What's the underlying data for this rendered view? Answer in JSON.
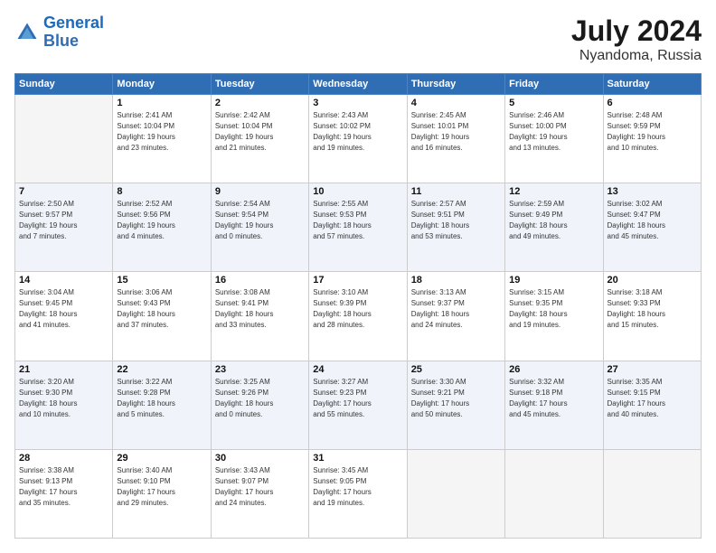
{
  "header": {
    "logo_line1": "General",
    "logo_line2": "Blue",
    "main_title": "July 2024",
    "subtitle": "Nyandoma, Russia"
  },
  "weekdays": [
    "Sunday",
    "Monday",
    "Tuesday",
    "Wednesday",
    "Thursday",
    "Friday",
    "Saturday"
  ],
  "weeks": [
    [
      {
        "day": "",
        "info": ""
      },
      {
        "day": "1",
        "info": "Sunrise: 2:41 AM\nSunset: 10:04 PM\nDaylight: 19 hours\nand 23 minutes."
      },
      {
        "day": "2",
        "info": "Sunrise: 2:42 AM\nSunset: 10:04 PM\nDaylight: 19 hours\nand 21 minutes."
      },
      {
        "day": "3",
        "info": "Sunrise: 2:43 AM\nSunset: 10:02 PM\nDaylight: 19 hours\nand 19 minutes."
      },
      {
        "day": "4",
        "info": "Sunrise: 2:45 AM\nSunset: 10:01 PM\nDaylight: 19 hours\nand 16 minutes."
      },
      {
        "day": "5",
        "info": "Sunrise: 2:46 AM\nSunset: 10:00 PM\nDaylight: 19 hours\nand 13 minutes."
      },
      {
        "day": "6",
        "info": "Sunrise: 2:48 AM\nSunset: 9:59 PM\nDaylight: 19 hours\nand 10 minutes."
      }
    ],
    [
      {
        "day": "7",
        "info": "Sunrise: 2:50 AM\nSunset: 9:57 PM\nDaylight: 19 hours\nand 7 minutes."
      },
      {
        "day": "8",
        "info": "Sunrise: 2:52 AM\nSunset: 9:56 PM\nDaylight: 19 hours\nand 4 minutes."
      },
      {
        "day": "9",
        "info": "Sunrise: 2:54 AM\nSunset: 9:54 PM\nDaylight: 19 hours\nand 0 minutes."
      },
      {
        "day": "10",
        "info": "Sunrise: 2:55 AM\nSunset: 9:53 PM\nDaylight: 18 hours\nand 57 minutes."
      },
      {
        "day": "11",
        "info": "Sunrise: 2:57 AM\nSunset: 9:51 PM\nDaylight: 18 hours\nand 53 minutes."
      },
      {
        "day": "12",
        "info": "Sunrise: 2:59 AM\nSunset: 9:49 PM\nDaylight: 18 hours\nand 49 minutes."
      },
      {
        "day": "13",
        "info": "Sunrise: 3:02 AM\nSunset: 9:47 PM\nDaylight: 18 hours\nand 45 minutes."
      }
    ],
    [
      {
        "day": "14",
        "info": "Sunrise: 3:04 AM\nSunset: 9:45 PM\nDaylight: 18 hours\nand 41 minutes."
      },
      {
        "day": "15",
        "info": "Sunrise: 3:06 AM\nSunset: 9:43 PM\nDaylight: 18 hours\nand 37 minutes."
      },
      {
        "day": "16",
        "info": "Sunrise: 3:08 AM\nSunset: 9:41 PM\nDaylight: 18 hours\nand 33 minutes."
      },
      {
        "day": "17",
        "info": "Sunrise: 3:10 AM\nSunset: 9:39 PM\nDaylight: 18 hours\nand 28 minutes."
      },
      {
        "day": "18",
        "info": "Sunrise: 3:13 AM\nSunset: 9:37 PM\nDaylight: 18 hours\nand 24 minutes."
      },
      {
        "day": "19",
        "info": "Sunrise: 3:15 AM\nSunset: 9:35 PM\nDaylight: 18 hours\nand 19 minutes."
      },
      {
        "day": "20",
        "info": "Sunrise: 3:18 AM\nSunset: 9:33 PM\nDaylight: 18 hours\nand 15 minutes."
      }
    ],
    [
      {
        "day": "21",
        "info": "Sunrise: 3:20 AM\nSunset: 9:30 PM\nDaylight: 18 hours\nand 10 minutes."
      },
      {
        "day": "22",
        "info": "Sunrise: 3:22 AM\nSunset: 9:28 PM\nDaylight: 18 hours\nand 5 minutes."
      },
      {
        "day": "23",
        "info": "Sunrise: 3:25 AM\nSunset: 9:26 PM\nDaylight: 18 hours\nand 0 minutes."
      },
      {
        "day": "24",
        "info": "Sunrise: 3:27 AM\nSunset: 9:23 PM\nDaylight: 17 hours\nand 55 minutes."
      },
      {
        "day": "25",
        "info": "Sunrise: 3:30 AM\nSunset: 9:21 PM\nDaylight: 17 hours\nand 50 minutes."
      },
      {
        "day": "26",
        "info": "Sunrise: 3:32 AM\nSunset: 9:18 PM\nDaylight: 17 hours\nand 45 minutes."
      },
      {
        "day": "27",
        "info": "Sunrise: 3:35 AM\nSunset: 9:15 PM\nDaylight: 17 hours\nand 40 minutes."
      }
    ],
    [
      {
        "day": "28",
        "info": "Sunrise: 3:38 AM\nSunset: 9:13 PM\nDaylight: 17 hours\nand 35 minutes."
      },
      {
        "day": "29",
        "info": "Sunrise: 3:40 AM\nSunset: 9:10 PM\nDaylight: 17 hours\nand 29 minutes."
      },
      {
        "day": "30",
        "info": "Sunrise: 3:43 AM\nSunset: 9:07 PM\nDaylight: 17 hours\nand 24 minutes."
      },
      {
        "day": "31",
        "info": "Sunrise: 3:45 AM\nSunset: 9:05 PM\nDaylight: 17 hours\nand 19 minutes."
      },
      {
        "day": "",
        "info": ""
      },
      {
        "day": "",
        "info": ""
      },
      {
        "day": "",
        "info": ""
      }
    ]
  ]
}
